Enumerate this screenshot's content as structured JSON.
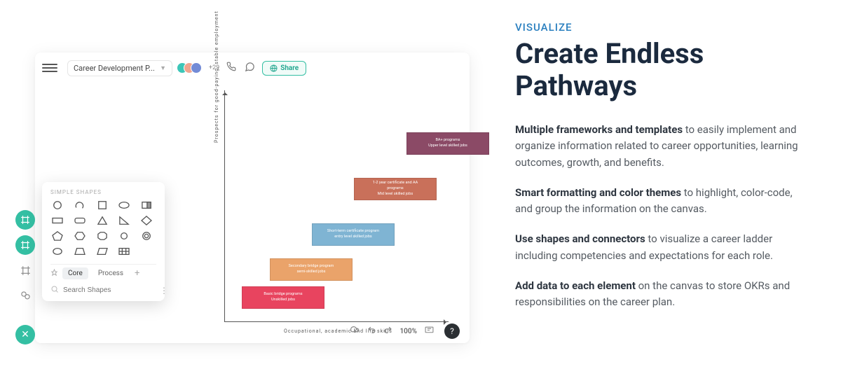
{
  "app": {
    "doc_title": "Career Development P...",
    "avatars_extra": "+29",
    "share_label": "Share"
  },
  "axes": {
    "y_label": "Prospects   for  good-paying,   stable   employment",
    "x_label": "Occupational,    academic    and    life   skills"
  },
  "steps": {
    "s1": {
      "line1": "Basic  bridge  programs",
      "line2": "Unskilled  jobs"
    },
    "s2": {
      "line1": "Secondary  bridge  program",
      "line2": "semi-skilled  jobs"
    },
    "s3": {
      "line1": "Short-term  certificate  program",
      "line2": "entry  level  skilled  jobs"
    },
    "s4": {
      "line1": "1-2  year  certificate   and  AA",
      "line2": "programs",
      "line3": "Mid  level  skilled  jobs"
    },
    "s5": {
      "line1": "BA+  programs",
      "line2": "Upper  level  skilled  jobs"
    }
  },
  "shapes_panel": {
    "heading": "SIMPLE SHAPES",
    "tab_core": "Core",
    "tab_process": "Process",
    "search_placeholder": "Search Shapes"
  },
  "bottombar": {
    "zoom": "100%"
  },
  "copy": {
    "eyebrow": "VISUALIZE",
    "heading": "Create Endless Pathways",
    "p1a": "Multiple frameworks and templates",
    "p1b": " to easily implement and organize information related to career opportunities, learning outcomes, growth, and benefits.",
    "p2a": "Smart formatting and color themes",
    "p2b": " to highlight, color-code, and group the information on the canvas.",
    "p3a": "Use shapes and connectors",
    "p3b": " to visualize a career ladder including competencies and expectations for each role.",
    "p4a": "Add data to each element",
    "p4b": " on the canvas to store OKRs and responsibilities on the career plan."
  }
}
